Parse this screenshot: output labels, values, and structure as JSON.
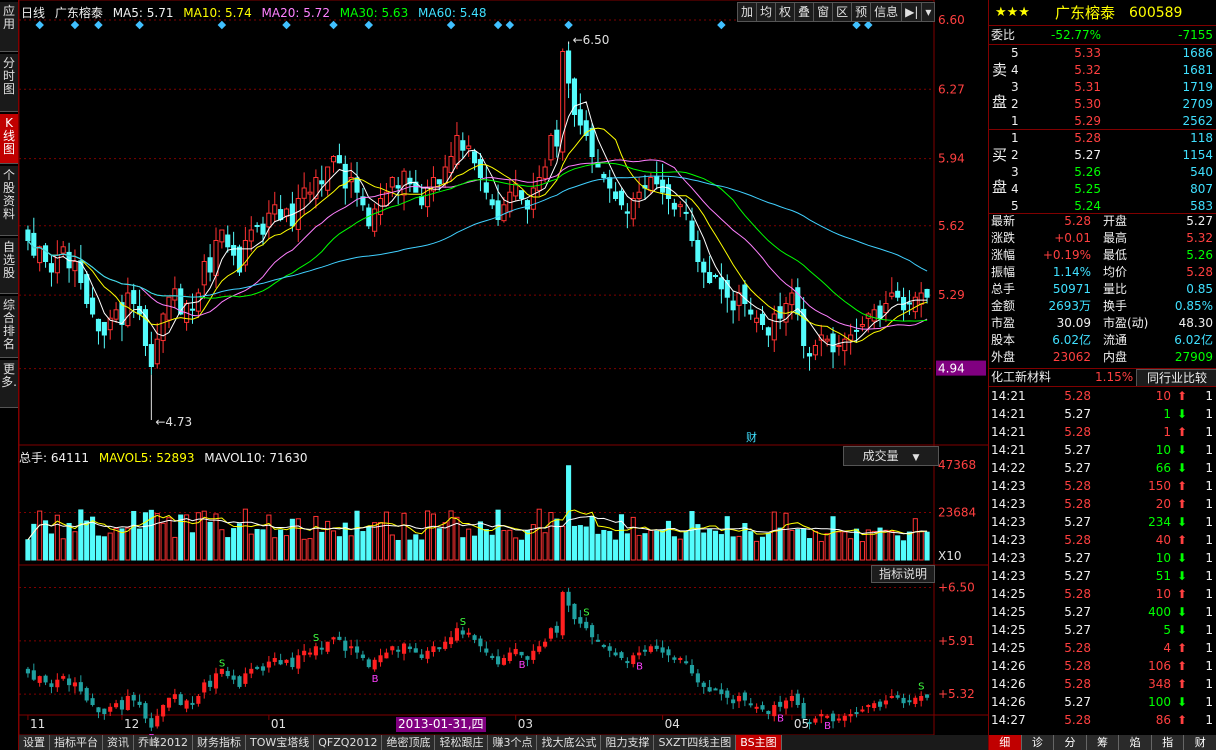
{
  "left_tabs": [
    {
      "label": "应用",
      "active": false
    },
    {
      "label": "分时图",
      "active": false
    },
    {
      "label": "K线图",
      "active": true
    },
    {
      "label": "个股资料",
      "active": false
    },
    {
      "label": "自选股",
      "active": false
    },
    {
      "label": "综合排名",
      "active": false
    },
    {
      "label": "更多.",
      "active": false
    }
  ],
  "header": {
    "period": "日线",
    "stock_name": "广东榕泰",
    "ma5": "MA5: 5.71",
    "ma10": "MA10: 5.74",
    "ma20": "MA20: 5.72",
    "ma30": "MA30: 5.63",
    "ma60": "MA60: 5.48"
  },
  "toolbar": [
    "加",
    "均",
    "权",
    "叠",
    "窗",
    "区",
    "预",
    "信息",
    "▶|"
  ],
  "price_axis": [
    "6.60",
    "6.27",
    "5.94",
    "5.62",
    "5.29",
    "4.94"
  ],
  "annotations": {
    "high": "6.50",
    "low": "4.73",
    "finance_marker": "财"
  },
  "volume_header": {
    "total": "总手: 64111",
    "mavol5": "MAVOL5: 52893",
    "mavol10": "MAVOL10: 71630",
    "dropdown": "成交量"
  },
  "volume_axis": [
    "47368",
    "23684",
    "X10"
  ],
  "indicator": {
    "help_button": "指标说明",
    "axis": [
      "+6.50",
      "+5.91",
      "+5.32"
    ]
  },
  "date_axis": {
    "labels": [
      "11",
      "12",
      "01",
      "03",
      "04",
      "05"
    ],
    "cursor_date": "2013-01-31,四"
  },
  "bottom_tabs": [
    "设置",
    "指标平台",
    "资讯",
    "乔峰2012",
    "财务指标",
    "TOW宝塔线",
    "QFZQ2012",
    "绝密顶底",
    "轻松跟庄",
    "赚3个点",
    "找大底公式",
    "阻力支撑",
    "SXZT四线主图",
    "BS主图"
  ],
  "quote": {
    "stars": "★★★",
    "name": "广东榕泰",
    "code": "600589",
    "weibi_label": "委比",
    "weibi_pct": "-52.77%",
    "weibi_val": "-7155",
    "sell_label": [
      "卖",
      "盘"
    ],
    "buy_label": [
      "买",
      "盘"
    ],
    "sell": [
      {
        "lvl": "5",
        "price": "5.33",
        "vol": "1686"
      },
      {
        "lvl": "4",
        "price": "5.32",
        "vol": "1681"
      },
      {
        "lvl": "3",
        "price": "5.31",
        "vol": "1719"
      },
      {
        "lvl": "2",
        "price": "5.30",
        "vol": "2709"
      },
      {
        "lvl": "1",
        "price": "5.29",
        "vol": "2562"
      }
    ],
    "buy": [
      {
        "lvl": "1",
        "price": "5.28",
        "vol": "118"
      },
      {
        "lvl": "2",
        "price": "5.27",
        "vol": "1154"
      },
      {
        "lvl": "3",
        "price": "5.26",
        "vol": "540"
      },
      {
        "lvl": "4",
        "price": "5.25",
        "vol": "807"
      },
      {
        "lvl": "5",
        "price": "5.24",
        "vol": "583"
      }
    ],
    "stats": [
      {
        "l1": "最新",
        "v1": "5.28",
        "c1": "red",
        "l2": "开盘",
        "v2": "5.27",
        "c2": "white"
      },
      {
        "l1": "涨跌",
        "v1": "+0.01",
        "c1": "red",
        "l2": "最高",
        "v2": "5.32",
        "c2": "red"
      },
      {
        "l1": "涨幅",
        "v1": "+0.19%",
        "c1": "red",
        "l2": "最低",
        "v2": "5.26",
        "c2": "green"
      },
      {
        "l1": "振幅",
        "v1": "1.14%",
        "c1": "cyan",
        "l2": "均价",
        "v2": "5.28",
        "c2": "red"
      },
      {
        "l1": "总手",
        "v1": "50971",
        "c1": "cyan",
        "l2": "量比",
        "v2": "0.85",
        "c2": "cyan"
      },
      {
        "l1": "金额",
        "v1": "2693万",
        "c1": "cyan",
        "l2": "换手",
        "v2": "0.85%",
        "c2": "cyan"
      },
      {
        "l1": "市盈",
        "v1": "30.09",
        "c1": "white",
        "l2": "市盈(动)",
        "v2": "48.30",
        "c2": "white"
      },
      {
        "l1": "股本",
        "v1": "6.02亿",
        "c1": "cyan",
        "l2": "流通",
        "v2": "6.02亿",
        "c2": "cyan"
      },
      {
        "l1": "外盘",
        "v1": "23062",
        "c1": "red",
        "l2": "内盘",
        "v2": "27909",
        "c2": "green"
      }
    ],
    "sector": {
      "name": "化工新材料",
      "pct": "1.15%",
      "compare_button": "同行业比较"
    },
    "ticks": [
      {
        "t": "14:21",
        "p": "5.28",
        "pc": "red",
        "v": "10",
        "d": "up",
        "n": "1"
      },
      {
        "t": "14:21",
        "p": "5.27",
        "pc": "white",
        "v": "1",
        "d": "down",
        "n": "1"
      },
      {
        "t": "14:21",
        "p": "5.28",
        "pc": "red",
        "v": "1",
        "d": "up",
        "n": "1"
      },
      {
        "t": "14:21",
        "p": "5.27",
        "pc": "white",
        "v": "10",
        "d": "down",
        "n": "1"
      },
      {
        "t": "14:22",
        "p": "5.27",
        "pc": "white",
        "v": "66",
        "d": "down",
        "n": "1"
      },
      {
        "t": "14:23",
        "p": "5.28",
        "pc": "red",
        "v": "150",
        "d": "up",
        "n": "1"
      },
      {
        "t": "14:23",
        "p": "5.28",
        "pc": "red",
        "v": "20",
        "d": "up",
        "n": "1"
      },
      {
        "t": "14:23",
        "p": "5.27",
        "pc": "white",
        "v": "234",
        "d": "down",
        "n": "1"
      },
      {
        "t": "14:23",
        "p": "5.28",
        "pc": "red",
        "v": "40",
        "d": "up",
        "n": "1"
      },
      {
        "t": "14:23",
        "p": "5.27",
        "pc": "white",
        "v": "10",
        "d": "down",
        "n": "1"
      },
      {
        "t": "14:23",
        "p": "5.27",
        "pc": "white",
        "v": "51",
        "d": "down",
        "n": "1"
      },
      {
        "t": "14:25",
        "p": "5.28",
        "pc": "red",
        "v": "10",
        "d": "up",
        "n": "1"
      },
      {
        "t": "14:25",
        "p": "5.27",
        "pc": "white",
        "v": "400",
        "d": "down",
        "n": "1"
      },
      {
        "t": "14:25",
        "p": "5.27",
        "pc": "white",
        "v": "5",
        "d": "down",
        "n": "1"
      },
      {
        "t": "14:25",
        "p": "5.28",
        "pc": "red",
        "v": "4",
        "d": "up",
        "n": "1"
      },
      {
        "t": "14:26",
        "p": "5.28",
        "pc": "red",
        "v": "106",
        "d": "up",
        "n": "1"
      },
      {
        "t": "14:26",
        "p": "5.28",
        "pc": "red",
        "v": "348",
        "d": "up",
        "n": "1"
      },
      {
        "t": "14:26",
        "p": "5.27",
        "pc": "white",
        "v": "100",
        "d": "down",
        "n": "1"
      },
      {
        "t": "14:27",
        "p": "5.28",
        "pc": "red",
        "v": "86",
        "d": "up",
        "n": "1"
      }
    ],
    "bottom_tabs": [
      "细",
      "诊",
      "分",
      "筹",
      "焰",
      "指",
      "财"
    ]
  },
  "colors": {
    "up": "#ff3232",
    "down": "#54fcfc",
    "ma5": "#ffffff",
    "ma10": "#ffff00",
    "ma20": "#ff80ff",
    "ma30": "#00ff00",
    "ma60": "#40d0ff",
    "border": "#800000"
  },
  "chart_data": {
    "type": "candlestick",
    "title": "广东榕泰 日线",
    "ylim": [
      4.6,
      6.6
    ],
    "y_ticks": [
      6.6,
      6.27,
      5.94,
      5.62,
      5.29,
      4.94
    ],
    "x_ticks": [
      "11",
      "12",
      "01",
      "03",
      "04",
      "05"
    ],
    "close": [
      5.55,
      5.48,
      5.52,
      5.45,
      5.4,
      5.48,
      5.52,
      5.42,
      5.45,
      5.35,
      5.25,
      5.2,
      5.12,
      5.1,
      5.18,
      5.22,
      5.15,
      5.3,
      5.25,
      5.2,
      5.05,
      4.95,
      5.08,
      5.2,
      5.28,
      5.32,
      5.2,
      5.25,
      5.22,
      5.3,
      5.45,
      5.4,
      5.55,
      5.6,
      5.52,
      5.48,
      5.4,
      5.55,
      5.6,
      5.62,
      5.58,
      5.68,
      5.72,
      5.65,
      5.7,
      5.62,
      5.75,
      5.8,
      5.78,
      5.85,
      5.82,
      5.9,
      5.95,
      5.92,
      5.8,
      5.85,
      5.78,
      5.72,
      5.62,
      5.7,
      5.75,
      5.78,
      5.85,
      5.8,
      5.88,
      5.82,
      5.78,
      5.72,
      5.8,
      5.85,
      5.82,
      5.9,
      5.95,
      6.05,
      5.98,
      6.0,
      5.92,
      5.85,
      5.78,
      5.72,
      5.65,
      5.72,
      5.78,
      5.82,
      5.75,
      5.7,
      5.8,
      5.85,
      5.9,
      6.05,
      6.0,
      6.45,
      6.3,
      6.15,
      6.1,
      6.05,
      5.95,
      5.9,
      5.85,
      5.8,
      5.75,
      5.72,
      5.68,
      5.75,
      5.78,
      5.8,
      5.85,
      5.82,
      5.78,
      5.75,
      5.7,
      5.72,
      5.68,
      5.55,
      5.45,
      5.4,
      5.35,
      5.38,
      5.32,
      5.28,
      5.22,
      5.3,
      5.25,
      5.2,
      5.18,
      5.15,
      5.1,
      5.2,
      5.18,
      5.25,
      5.3,
      5.2,
      5.05,
      5.0,
      5.05,
      5.1,
      5.08,
      5.02,
      5.05,
      5.08,
      5.1,
      5.12,
      5.15,
      5.2,
      5.22,
      5.18,
      5.25,
      5.3,
      5.28,
      5.22,
      5.25,
      5.28,
      5.3,
      5.28
    ],
    "mavol": [
      41000,
      46000,
      52893
    ]
  }
}
